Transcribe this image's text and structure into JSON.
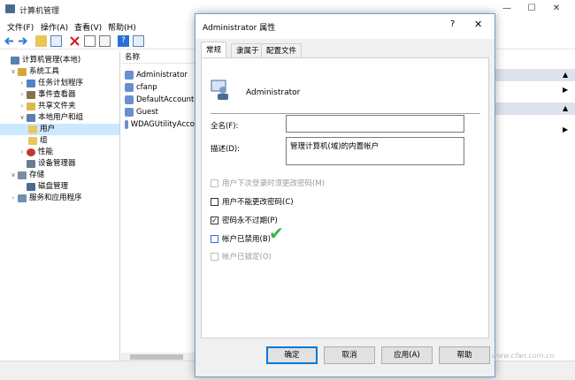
{
  "app": {
    "title": "计算机管理",
    "window_controls": [
      "—",
      "☐",
      "✕"
    ]
  },
  "menu": [
    "文件(F)",
    "操作(A)",
    "查看(V)",
    "帮助(H)"
  ],
  "tree": {
    "items": [
      {
        "label": "计算机管理(本地)",
        "expander": "",
        "icon_color": "#5a7fb0"
      },
      {
        "label": "系统工具",
        "expander": "∨",
        "icon_color": "#d4a73a"
      },
      {
        "label": "任务计划程序",
        "expander": "›",
        "icon_color": "#4f83c9"
      },
      {
        "label": "事件查看器",
        "expander": "›",
        "icon_color": "#8a6f4e"
      },
      {
        "label": "共享文件夹",
        "expander": "›",
        "icon_color": "#e0b84a"
      },
      {
        "label": "本地用户和组",
        "expander": "∨",
        "icon_color": "#5a7fb0"
      },
      {
        "label": "用户",
        "expander": "",
        "icon_color": "#e8c65a",
        "selected": true
      },
      {
        "label": "组",
        "expander": "",
        "icon_color": "#e8c65a"
      },
      {
        "label": "性能",
        "expander": "›",
        "icon_color": "#c0392b"
      },
      {
        "label": "设备管理器",
        "expander": "",
        "icon_color": "#6b7c8f"
      },
      {
        "label": "存储",
        "expander": "∨",
        "icon_color": "#7d8da1"
      },
      {
        "label": "磁盘管理",
        "expander": "",
        "icon_color": "#4a6c93"
      },
      {
        "label": "服务和应用程序",
        "expander": "›",
        "icon_color": "#6f8fb3"
      }
    ]
  },
  "list": {
    "header": "名称",
    "rows": [
      "Administrator",
      "cfanp",
      "DefaultAccount",
      "Guest",
      "WDAGUtilityAcco"
    ]
  },
  "actions": {
    "arrows": [
      "▲",
      "▶",
      "▶",
      "▲"
    ]
  },
  "dialog": {
    "title": "Administrator 属性",
    "help": "?",
    "close": "✕",
    "tabs": [
      "常规",
      "隶属于",
      "配置文件"
    ],
    "username": "Administrator",
    "fullname_label": "全名(F):",
    "fullname_value": "",
    "description_label": "描述(D):",
    "description_value": "管理计算机(域)的内置帐户",
    "checkboxes": [
      {
        "label": "用户下次登录时须更改密码(M)",
        "checked": false,
        "disabled": true
      },
      {
        "label": "用户不能更改密码(C)",
        "checked": false,
        "disabled": false
      },
      {
        "label": "密码永不过期(P)",
        "checked": true,
        "disabled": false
      },
      {
        "label": "帐户已禁用(B)",
        "checked": false,
        "disabled": false
      },
      {
        "label": "帐户已锁定(O)",
        "checked": false,
        "disabled": true
      }
    ],
    "check_mark": "✓",
    "annotation_mark": "✔",
    "annotation_color": "#2db84a",
    "buttons": [
      "确定",
      "取消",
      "应用(A)",
      "帮助"
    ]
  },
  "watermark": "www.cfan.com.cn"
}
